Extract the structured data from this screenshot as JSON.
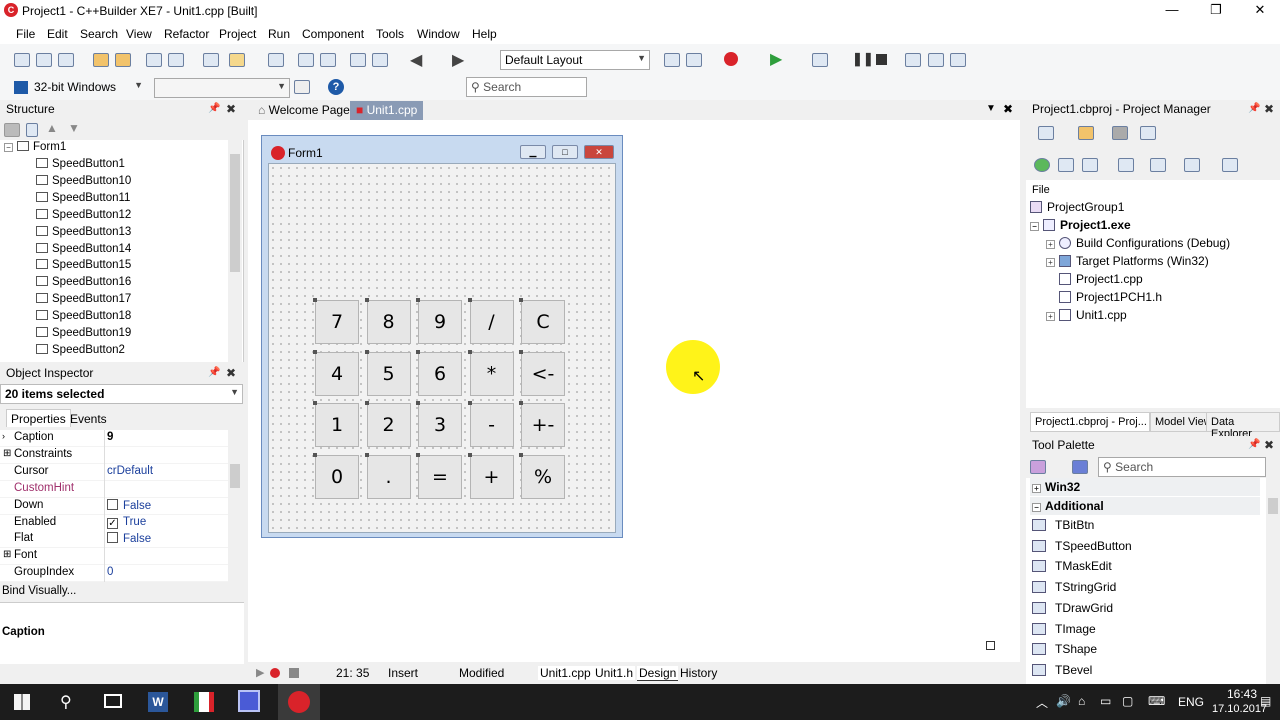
{
  "window": {
    "title": "Project1 - C++Builder XE7 - Unit1.cpp [Built]",
    "logo": "C"
  },
  "window_controls": {
    "minimize": "—",
    "maximize": "❐",
    "close": "✕"
  },
  "menu": [
    "File",
    "Edit",
    "Search",
    "View",
    "Refactor",
    "Project",
    "Run",
    "Component",
    "Tools",
    "Window",
    "Help"
  ],
  "toolbar": {
    "layout_combo": "Default Layout",
    "platform_combo": "32-bit Windows",
    "search_placeholder": "Search"
  },
  "structure": {
    "title": "Structure",
    "root": "Form1",
    "items": [
      "SpeedButton1",
      "SpeedButton10",
      "SpeedButton11",
      "SpeedButton12",
      "SpeedButton13",
      "SpeedButton14",
      "SpeedButton15",
      "SpeedButton16",
      "SpeedButton17",
      "SpeedButton18",
      "SpeedButton19",
      "SpeedButton2"
    ]
  },
  "inspector": {
    "title": "Object Inspector",
    "selection": "20 items selected",
    "tabs": [
      "Properties",
      "Events"
    ],
    "properties": [
      {
        "name": "Caption",
        "value": "9"
      },
      {
        "name": "Constraints",
        "value": ""
      },
      {
        "name": "Cursor",
        "value": "crDefault"
      },
      {
        "name": "CustomHint",
        "value": ""
      },
      {
        "name": "Down",
        "value": "False"
      },
      {
        "name": "Enabled",
        "value": "True"
      },
      {
        "name": "Flat",
        "value": "False"
      },
      {
        "name": "Font",
        "value": ""
      },
      {
        "name": "GroupIndex",
        "value": "0"
      }
    ],
    "bind_visually": "Bind Visually...",
    "footer_caption": "Caption"
  },
  "editor": {
    "tabs": [
      "Welcome Page",
      "Unit1.cpp"
    ],
    "form_title": "Form1",
    "buttons": [
      [
        "7",
        "8",
        "9",
        "/",
        "C"
      ],
      [
        "4",
        "5",
        "6",
        "*",
        "<-"
      ],
      [
        "1",
        "2",
        "3",
        "-",
        "+-"
      ],
      [
        "0",
        ".",
        "=",
        "+",
        "%"
      ]
    ]
  },
  "project_manager": {
    "title": "Project1.cbproj - Project Manager",
    "file_label": "File",
    "group": "ProjectGroup1",
    "exe": "Project1.exe",
    "children": [
      "Build Configurations (Debug)",
      "Target Platforms (Win32)",
      "Project1.cpp",
      "Project1PCH1.h",
      "Unit1.cpp"
    ],
    "tabs": [
      "Project1.cbproj - Proj...",
      "Model View",
      "Data Explorer"
    ]
  },
  "tool_palette": {
    "title": "Tool Palette",
    "search_placeholder": "Search",
    "categories": [
      "Win32",
      "Additional"
    ],
    "items": [
      "TBitBtn",
      "TSpeedButton",
      "TMaskEdit",
      "TStringGrid",
      "TDrawGrid",
      "TImage",
      "TShape",
      "TBevel"
    ]
  },
  "status": {
    "position": "21: 35",
    "mode": "Insert",
    "state": "Modified",
    "file_tabs": [
      "Unit1.cpp",
      "Unit1.h",
      "Design",
      "History"
    ]
  },
  "taskbar": {
    "language": "ENG",
    "time": "16:43",
    "date": "17.10.2017"
  }
}
